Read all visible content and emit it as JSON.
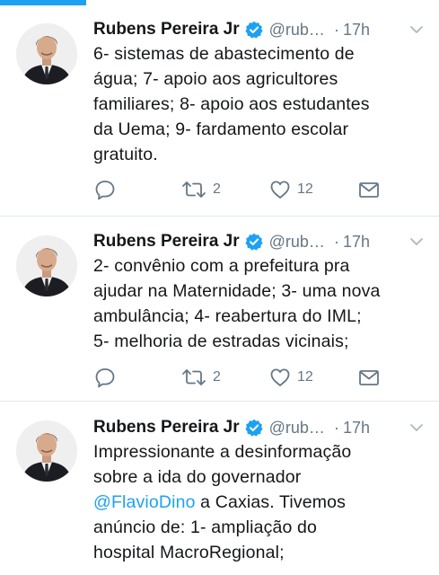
{
  "colors": {
    "accent": "#1da1f2",
    "text": "#14171a",
    "secondary": "#657786",
    "divider": "#e1e8ed"
  },
  "tweets": [
    {
      "author": "Rubens Pereira Jr",
      "handle": "@rub…",
      "separator": "·",
      "time": "17h",
      "verified": true,
      "text_lines": [
        "6- sistemas de abastecimento de",
        "água; 7- apoio aos agricultores",
        "familiares; 8- apoio aos estudantes",
        "da Uema; 9- fardamento escolar",
        "gratuito."
      ],
      "retweets": "2",
      "likes": "12"
    },
    {
      "author": "Rubens Pereira Jr",
      "handle": "@rub…",
      "separator": "·",
      "time": "17h",
      "verified": true,
      "text_lines": [
        "2- convênio com a prefeitura pra",
        "ajudar na Maternidade; 3- uma nova",
        "ambulância; 4- reabertura do IML;",
        "5- melhoria de estradas vicinais;"
      ],
      "retweets": "2",
      "likes": "12"
    },
    {
      "author": "Rubens Pereira Jr",
      "handle": "@rub…",
      "separator": "·",
      "time": "17h",
      "verified": true,
      "text_lines": [
        "Impressionante a desinformação",
        "sobre a ida do governador",
        "a Caxias. Tivemos",
        "anúncio de: 1- ampliação do",
        "hospital MacroRegional;"
      ],
      "mention": "@FlavioDino"
    }
  ]
}
